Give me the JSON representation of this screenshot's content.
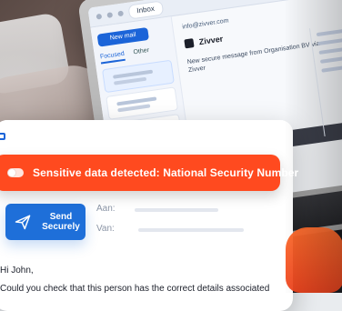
{
  "laptop": {
    "browser_tab": "Inbox",
    "new_mail_label": "New mail",
    "folder_tabs": [
      "Focused",
      "Other"
    ],
    "reading_from": "info@zivver.com",
    "brand_name": "Zivver",
    "notice": "New secure message from Organisation BV via Zivver"
  },
  "alert": {
    "text": "Sensitive data detected: National Security Number"
  },
  "compose": {
    "send_button": {
      "label": "Send\nSecurely"
    },
    "fields": {
      "to_label": "Aan:",
      "from_label": "Van:"
    },
    "message": {
      "greeting": "Hi John,",
      "line1": "Could you check that this person has the correct details associated"
    }
  },
  "colors": {
    "alert": "#ff4a1f",
    "primary": "#1e6fd9"
  }
}
